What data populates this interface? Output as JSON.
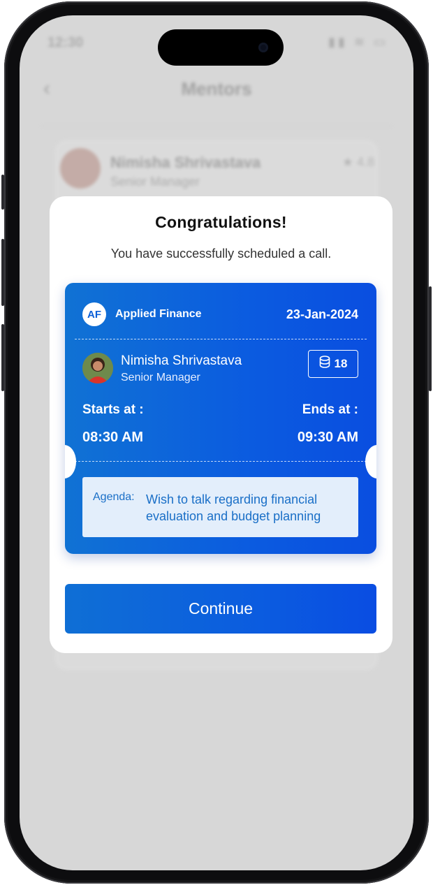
{
  "background": {
    "status_time": "12:30",
    "status_right": "▮▮ ≋ ▭",
    "back_label": "‹",
    "title": "Mentors",
    "mentor_name": "Nimisha Shrivastava",
    "mentor_role": "Senior Manager",
    "rating": "★ 4.8"
  },
  "modal": {
    "title": "Congratulations!",
    "subtitle": "You have successfully scheduled a call.",
    "ticket": {
      "company_initials": "AF",
      "company_name": "Applied Finance",
      "date": "23-Jan-2024",
      "mentor_name": "Nimisha Shrivastava",
      "mentor_role": "Senior Manager",
      "coins": "18",
      "coin_icon": "coins-icon",
      "starts_label": "Starts at :",
      "ends_label": "Ends at :",
      "start_time": "08:30 AM",
      "end_time": "09:30 AM",
      "agenda_label": "Agenda:",
      "agenda_text": "Wish to talk regarding financial evaluation and budget planning"
    },
    "continue_label": "Continue"
  },
  "colors": {
    "primary": "#0b5be0",
    "agenda_bg": "#e3eefb",
    "agenda_text": "#1a6fc7"
  }
}
